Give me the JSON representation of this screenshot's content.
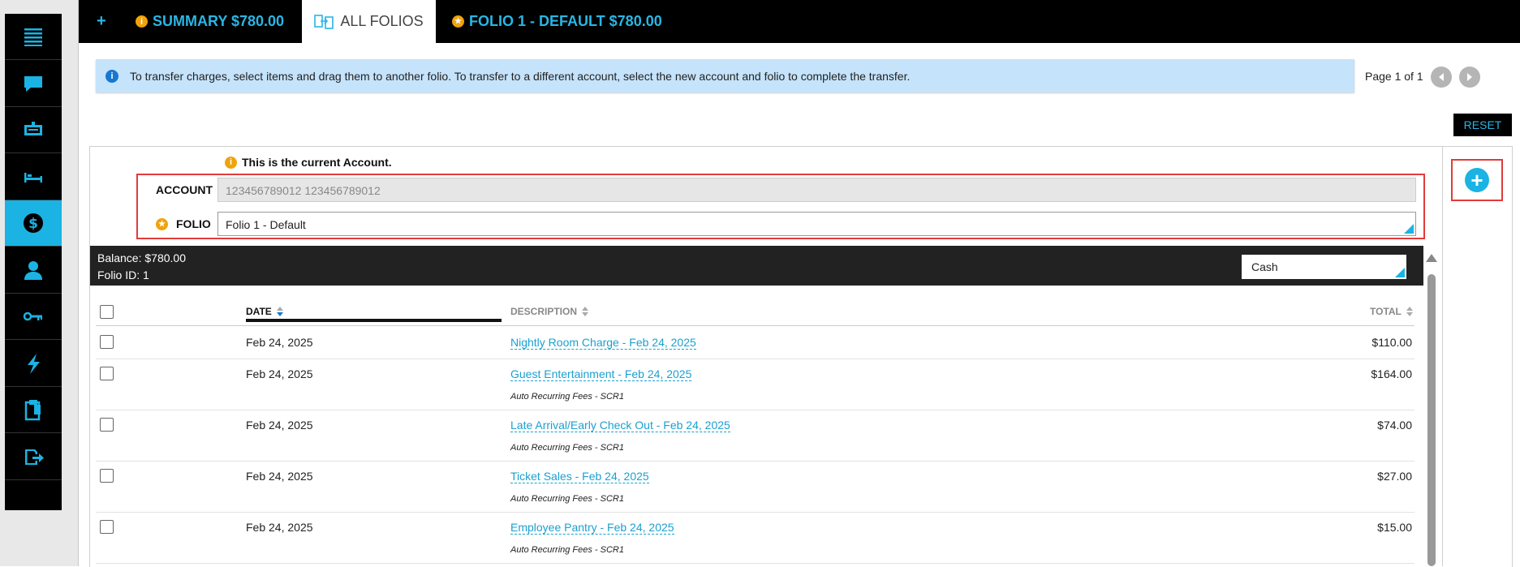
{
  "tabs": {
    "add": "+",
    "summary": "SUMMARY $780.00",
    "all_folios": "ALL FOLIOS",
    "folio1": "FOLIO 1 - DEFAULT $780.00"
  },
  "banner": {
    "text": "To transfer charges, select items and drag them to another folio. To transfer to a different account, select the new account and folio to complete the transfer."
  },
  "pager": {
    "text": "Page 1 of 1"
  },
  "reset_label": "RESET",
  "current_note": "This is the current Account.",
  "account": {
    "label": "ACCOUNT",
    "value": "123456789012 123456789012"
  },
  "folio": {
    "label": "FOLIO",
    "value": "Folio 1 - Default"
  },
  "balance": {
    "line1": "Balance: $780.00",
    "line2": "Folio ID: 1",
    "payment_method": "Cash"
  },
  "table": {
    "headers": {
      "date": "DATE",
      "description": "DESCRIPTION",
      "total": "TOTAL"
    },
    "rows": [
      {
        "date": "Feb 24, 2025",
        "description": "Nightly Room Charge - Feb 24, 2025",
        "sub": "",
        "total": "$110.00"
      },
      {
        "date": "Feb 24, 2025",
        "description": "Guest Entertainment - Feb 24, 2025",
        "sub": "Auto Recurring Fees - SCR1",
        "total": "$164.00"
      },
      {
        "date": "Feb 24, 2025",
        "description": "Late Arrival/Early Check Out - Feb 24, 2025",
        "sub": "Auto Recurring Fees - SCR1",
        "total": "$74.00"
      },
      {
        "date": "Feb 24, 2025",
        "description": "Ticket Sales - Feb 24, 2025",
        "sub": "Auto Recurring Fees - SCR1",
        "total": "$27.00"
      },
      {
        "date": "Feb 24, 2025",
        "description": "Employee Pantry - Feb 24, 2025",
        "sub": "Auto Recurring Fees - SCR1",
        "total": "$15.00"
      }
    ]
  },
  "rail_icons": [
    "menu-icon",
    "chat-icon",
    "reservation-icon",
    "bed-icon",
    "dollar-icon",
    "guest-icon",
    "key-icon",
    "lightning-icon",
    "clipboard-icon",
    "export-icon"
  ],
  "colors": {
    "accent": "#1bb3e3",
    "warning": "#f0a30a",
    "highlight": "#e23b3b",
    "banner": "#c5e3fb"
  }
}
